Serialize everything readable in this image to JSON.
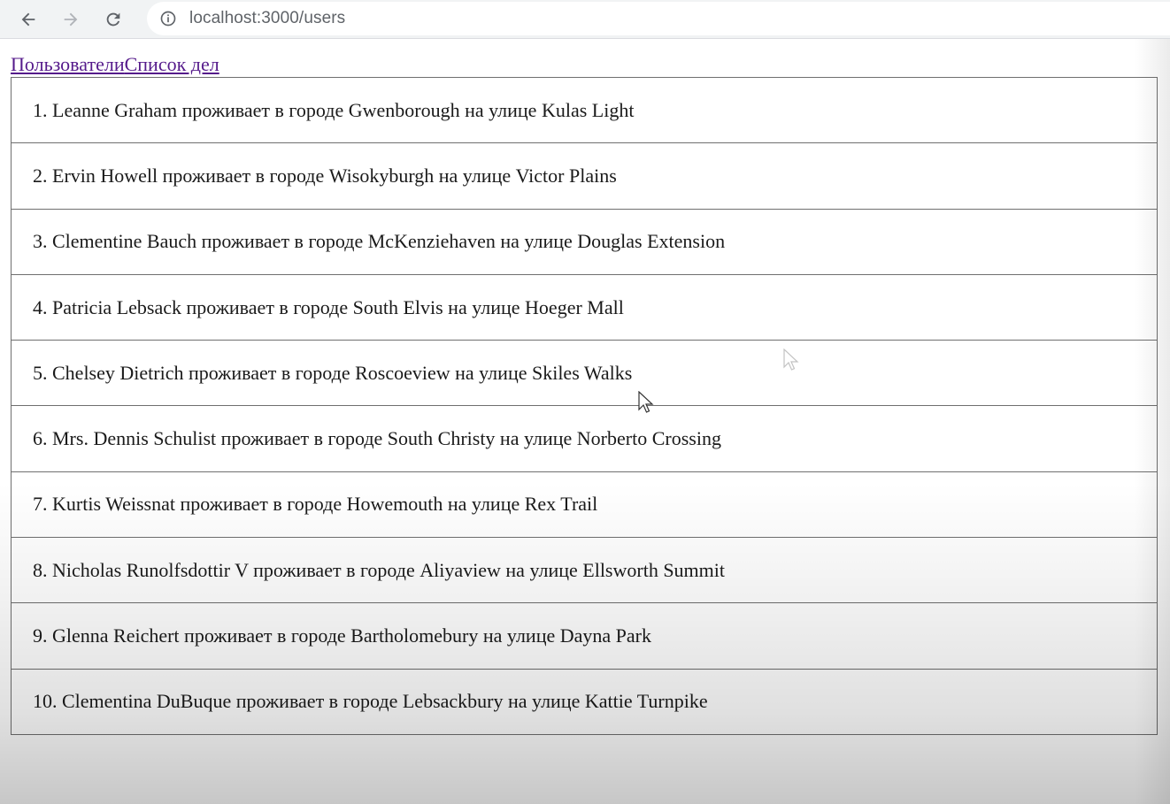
{
  "browser": {
    "url": "localhost:3000/users",
    "icons": [
      "back-arrow-icon",
      "forward-arrow-icon",
      "reload-icon",
      "info-icon"
    ]
  },
  "nav": {
    "users_link": "Пользователи",
    "todos_link": "Список дел"
  },
  "users": [
    {
      "text": "1. Leanne Graham проживает в городе Gwenborough на улице Kulas Light"
    },
    {
      "text": "2. Ervin Howell проживает в городе Wisokyburgh на улице Victor Plains"
    },
    {
      "text": "3. Clementine Bauch проживает в городе McKenziehaven на улице Douglas Extension"
    },
    {
      "text": "4. Patricia Lebsack проживает в городе South Elvis на улице Hoeger Mall"
    },
    {
      "text": "5. Chelsey Dietrich проживает в городе Roscoeview на улице Skiles Walks"
    },
    {
      "text": "6. Mrs. Dennis Schulist проживает в городе South Christy на улице Norberto Crossing"
    },
    {
      "text": "7. Kurtis Weissnat проживает в городе Howemouth на улице Rex Trail"
    },
    {
      "text": "8. Nicholas Runolfsdottir V проживает в городе Aliyaview на улице Ellsworth Summit"
    },
    {
      "text": "9. Glenna Reichert проживает в городе Bartholomebury на улице Dayna Park"
    },
    {
      "text": "10. Clementina DuBuque проживает в городе Lebsackbury на улице Kattie Turnpike"
    }
  ],
  "colors": {
    "link": "#551a8b",
    "border": "#6f6f6f",
    "toolbar": "#f1f3f4"
  }
}
